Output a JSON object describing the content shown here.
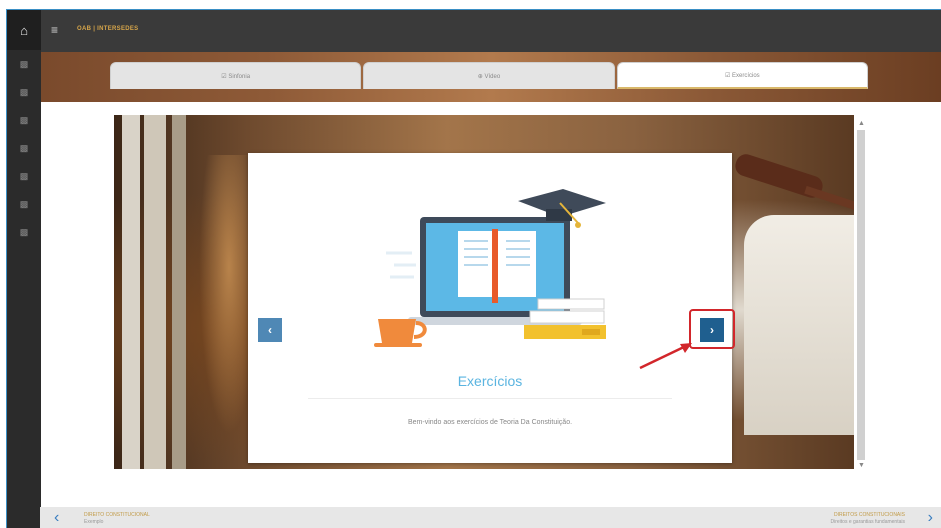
{
  "app": {
    "title": "OAB | INTERSEDES"
  },
  "rail": {
    "home_icon": "home-icon",
    "items": [
      "doc-icon",
      "doc-icon",
      "doc-icon",
      "doc-icon",
      "doc-icon",
      "doc-icon",
      "doc-icon"
    ]
  },
  "tabs": [
    {
      "label": "☑ Sinfonia",
      "active": false
    },
    {
      "label": "⊕ Vídeo",
      "active": false
    },
    {
      "label": "☑ Exercícios",
      "active": true
    }
  ],
  "card": {
    "heading": "Exercícios",
    "body": "Bem-vindo aos exercícios de Teoria Da Constituição."
  },
  "nav": {
    "prev_symbol": "‹",
    "next_symbol": "›"
  },
  "bottom": {
    "left_title": "DIREITO CONSTITUCIONAL",
    "left_sub": "Exemplo",
    "right_title": "DIREITOS CONSTITUCIONAIS",
    "right_sub": "Direitos e garantias fundamentais"
  },
  "colors": {
    "accent": "#5ab4e0",
    "highlight": "#d2262b",
    "next_button": "#1f5f8f",
    "prev_button": "#4f88b5"
  }
}
